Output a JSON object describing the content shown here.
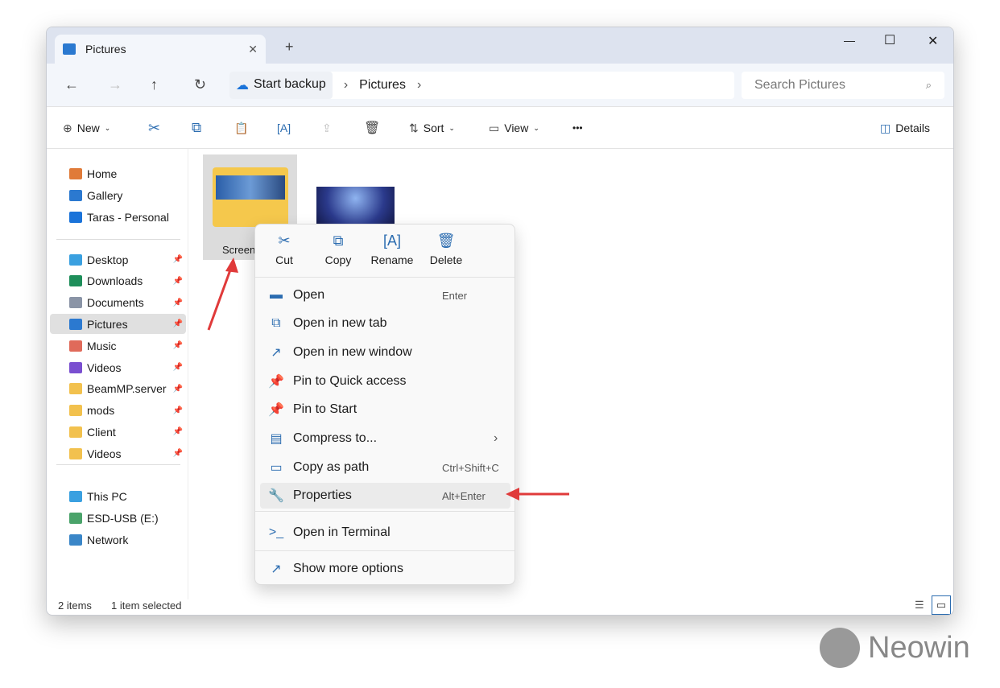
{
  "window": {
    "tab_title": "Pictures",
    "new_tab": "+",
    "close_tab": "✕",
    "minimize": "—",
    "maximize": "☐",
    "close": "✕"
  },
  "address": {
    "crumbs": [
      "Start backup",
      "Pictures"
    ],
    "search_placeholder": "Search Pictures"
  },
  "toolbar": {
    "new": "New",
    "sort": "Sort",
    "view": "View",
    "more": "•••",
    "details": "Details"
  },
  "sidebar": {
    "top": [
      {
        "label": "Home",
        "color": "#e07b39"
      },
      {
        "label": "Gallery",
        "color": "#2b79d0"
      },
      {
        "label": "Taras - Personal",
        "color": "#1a73d9"
      }
    ],
    "pinned": [
      {
        "label": "Desktop",
        "color": "#3aa0e0"
      },
      {
        "label": "Downloads",
        "color": "#1e8e5a"
      },
      {
        "label": "Documents",
        "color": "#8a94a6"
      },
      {
        "label": "Pictures",
        "color": "#2b79d0",
        "selected": true
      },
      {
        "label": "Music",
        "color": "#e06a5a"
      },
      {
        "label": "Videos",
        "color": "#7a4fd0"
      },
      {
        "label": "BeamMP.server",
        "color": "#f2c14e"
      },
      {
        "label": "mods",
        "color": "#f2c14e"
      },
      {
        "label": "Client",
        "color": "#f2c14e"
      },
      {
        "label": "Videos",
        "color": "#f2c14e"
      }
    ],
    "devices": [
      {
        "label": "This PC",
        "color": "#3aa0e0"
      },
      {
        "label": "ESD-USB (E:)",
        "color": "#4aa36a"
      },
      {
        "label": "Network",
        "color": "#3a86c8"
      }
    ]
  },
  "files": [
    {
      "name": "Screen"
    }
  ],
  "status": {
    "count": "2 items",
    "selected": "1 item selected"
  },
  "context_menu": {
    "quick": [
      {
        "label": "Cut",
        "icon": "✂"
      },
      {
        "label": "Copy",
        "icon": "⧉"
      },
      {
        "label": "Rename",
        "icon": "[A]"
      },
      {
        "label": "Delete",
        "icon": "🗑"
      }
    ],
    "items": [
      {
        "label": "Open",
        "shortcut": "Enter",
        "icon": "▬"
      },
      {
        "label": "Open in new tab",
        "shortcut": "",
        "icon": "⧉"
      },
      {
        "label": "Open in new window",
        "shortcut": "",
        "icon": "↗"
      },
      {
        "label": "Pin to Quick access",
        "shortcut": "",
        "icon": "📌"
      },
      {
        "label": "Pin to Start",
        "shortcut": "",
        "icon": "📌"
      },
      {
        "label": "Compress to...",
        "shortcut": "›",
        "icon": "▤"
      },
      {
        "label": "Copy as path",
        "shortcut": "Ctrl+Shift+C",
        "icon": "▭"
      },
      {
        "label": "Properties",
        "shortcut": "Alt+Enter",
        "icon": "🔧"
      },
      {
        "label": "Open in Terminal",
        "shortcut": "",
        "icon": ">_"
      },
      {
        "label": "Show more options",
        "shortcut": "",
        "icon": "↗"
      }
    ]
  },
  "watermark": "Neowin",
  "colors": {
    "accent": "#0067c0",
    "arrow": "#e03a3a"
  }
}
